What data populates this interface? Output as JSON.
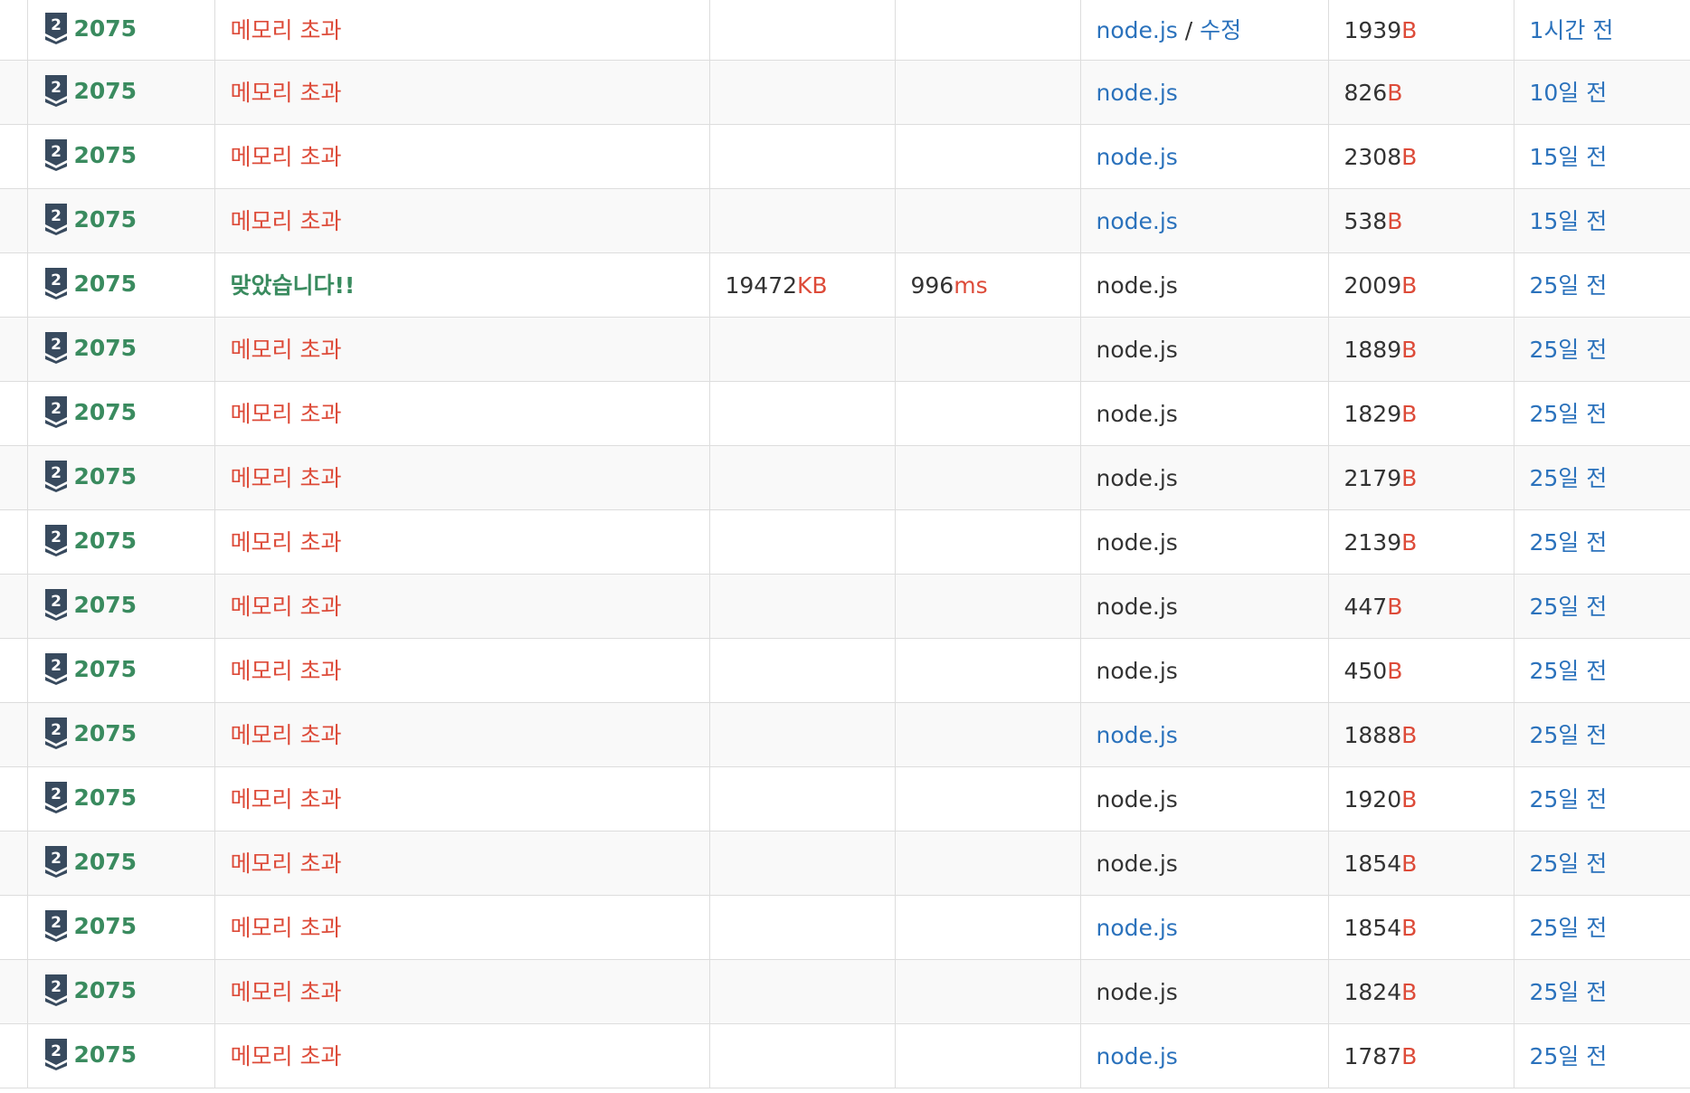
{
  "theme": {
    "problem_color": "#3a8b5f",
    "memory_exceeded_color": "#dd4b39",
    "accepted_color": "#3a8b5f",
    "unit_color": "#dd4b39",
    "link_color": "#2b72bc",
    "border_color": "#dddddd",
    "tier_icon_color": "#384a5e"
  },
  "units": {
    "memory": "KB",
    "time": "ms",
    "code_length": "B"
  },
  "edit_label": "수정",
  "rows": [
    {
      "problem": "2075",
      "tier_number": "2",
      "result": "메모리 초과",
      "result_type": "mle",
      "memory": "",
      "time": "",
      "language": "node.js",
      "language_link": true,
      "edit": true,
      "code_length": "1939",
      "submitted": "1시간 전"
    },
    {
      "problem": "2075",
      "tier_number": "2",
      "result": "메모리 초과",
      "result_type": "mle",
      "memory": "",
      "time": "",
      "language": "node.js",
      "language_link": true,
      "edit": false,
      "code_length": "826",
      "submitted": "10일 전"
    },
    {
      "problem": "2075",
      "tier_number": "2",
      "result": "메모리 초과",
      "result_type": "mle",
      "memory": "",
      "time": "",
      "language": "node.js",
      "language_link": true,
      "edit": false,
      "code_length": "2308",
      "submitted": "15일 전"
    },
    {
      "problem": "2075",
      "tier_number": "2",
      "result": "메모리 초과",
      "result_type": "mle",
      "memory": "",
      "time": "",
      "language": "node.js",
      "language_link": true,
      "edit": false,
      "code_length": "538",
      "submitted": "15일 전"
    },
    {
      "problem": "2075",
      "tier_number": "2",
      "result": "맞았습니다!!",
      "result_type": "ac",
      "memory": "19472",
      "time": "996",
      "language": "node.js",
      "language_link": false,
      "edit": false,
      "code_length": "2009",
      "submitted": "25일 전"
    },
    {
      "problem": "2075",
      "tier_number": "2",
      "result": "메모리 초과",
      "result_type": "mle",
      "memory": "",
      "time": "",
      "language": "node.js",
      "language_link": false,
      "edit": false,
      "code_length": "1889",
      "submitted": "25일 전"
    },
    {
      "problem": "2075",
      "tier_number": "2",
      "result": "메모리 초과",
      "result_type": "mle",
      "memory": "",
      "time": "",
      "language": "node.js",
      "language_link": false,
      "edit": false,
      "code_length": "1829",
      "submitted": "25일 전"
    },
    {
      "problem": "2075",
      "tier_number": "2",
      "result": "메모리 초과",
      "result_type": "mle",
      "memory": "",
      "time": "",
      "language": "node.js",
      "language_link": false,
      "edit": false,
      "code_length": "2179",
      "submitted": "25일 전"
    },
    {
      "problem": "2075",
      "tier_number": "2",
      "result": "메모리 초과",
      "result_type": "mle",
      "memory": "",
      "time": "",
      "language": "node.js",
      "language_link": false,
      "edit": false,
      "code_length": "2139",
      "submitted": "25일 전"
    },
    {
      "problem": "2075",
      "tier_number": "2",
      "result": "메모리 초과",
      "result_type": "mle",
      "memory": "",
      "time": "",
      "language": "node.js",
      "language_link": false,
      "edit": false,
      "code_length": "447",
      "submitted": "25일 전"
    },
    {
      "problem": "2075",
      "tier_number": "2",
      "result": "메모리 초과",
      "result_type": "mle",
      "memory": "",
      "time": "",
      "language": "node.js",
      "language_link": false,
      "edit": false,
      "code_length": "450",
      "submitted": "25일 전"
    },
    {
      "problem": "2075",
      "tier_number": "2",
      "result": "메모리 초과",
      "result_type": "mle",
      "memory": "",
      "time": "",
      "language": "node.js",
      "language_link": true,
      "edit": false,
      "code_length": "1888",
      "submitted": "25일 전"
    },
    {
      "problem": "2075",
      "tier_number": "2",
      "result": "메모리 초과",
      "result_type": "mle",
      "memory": "",
      "time": "",
      "language": "node.js",
      "language_link": false,
      "edit": false,
      "code_length": "1920",
      "submitted": "25일 전"
    },
    {
      "problem": "2075",
      "tier_number": "2",
      "result": "메모리 초과",
      "result_type": "mle",
      "memory": "",
      "time": "",
      "language": "node.js",
      "language_link": false,
      "edit": false,
      "code_length": "1854",
      "submitted": "25일 전"
    },
    {
      "problem": "2075",
      "tier_number": "2",
      "result": "메모리 초과",
      "result_type": "mle",
      "memory": "",
      "time": "",
      "language": "node.js",
      "language_link": true,
      "edit": false,
      "code_length": "1854",
      "submitted": "25일 전"
    },
    {
      "problem": "2075",
      "tier_number": "2",
      "result": "메모리 초과",
      "result_type": "mle",
      "memory": "",
      "time": "",
      "language": "node.js",
      "language_link": false,
      "edit": false,
      "code_length": "1824",
      "submitted": "25일 전"
    },
    {
      "problem": "2075",
      "tier_number": "2",
      "result": "메모리 초과",
      "result_type": "mle",
      "memory": "",
      "time": "",
      "language": "node.js",
      "language_link": true,
      "edit": false,
      "code_length": "1787",
      "submitted": "25일 전"
    }
  ]
}
